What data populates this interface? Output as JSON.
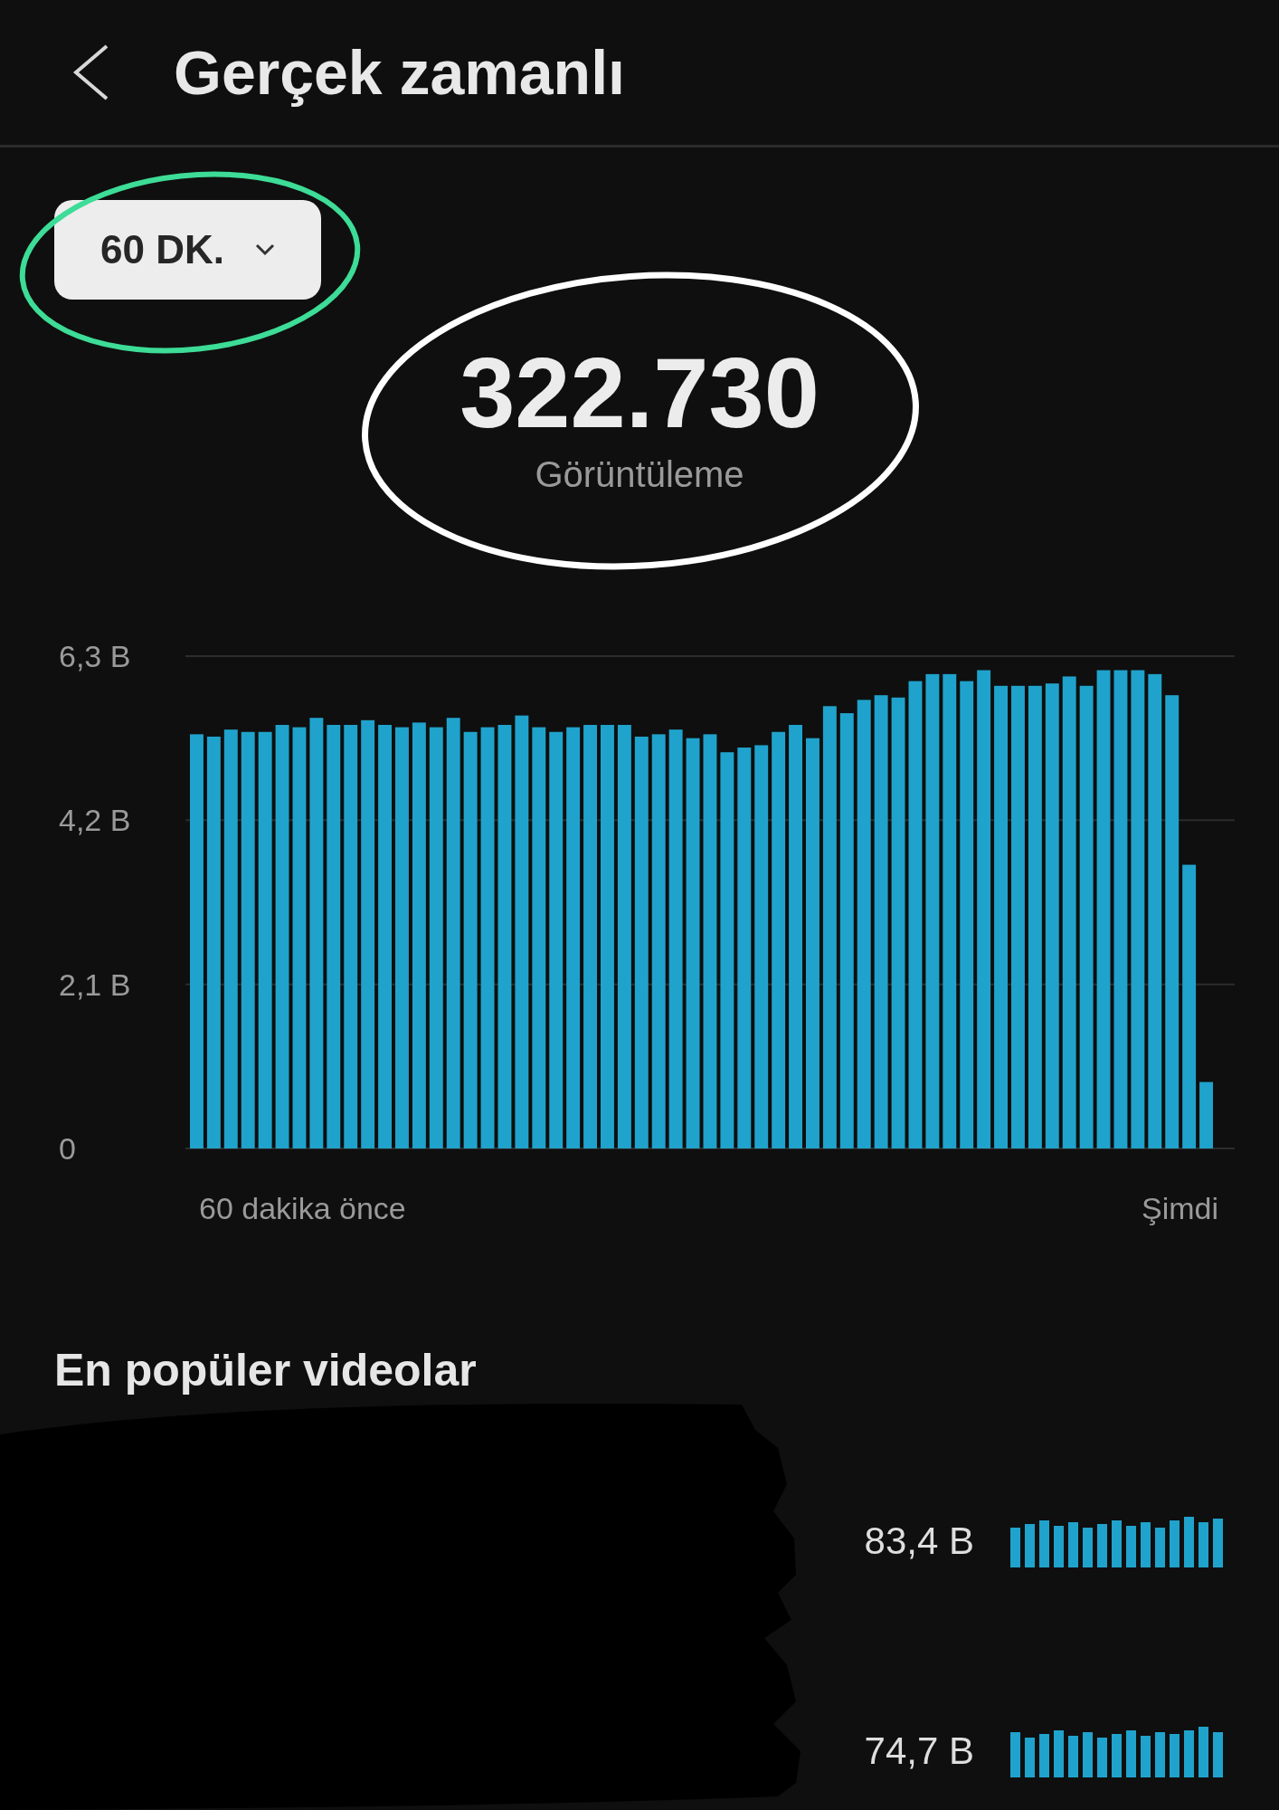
{
  "header": {
    "title": "Gerçek zamanlı"
  },
  "time_range": {
    "label": "60 DK."
  },
  "total": {
    "value": "322.730",
    "label": "Görüntüleme"
  },
  "chart": {
    "start_label": "60 dakika önce",
    "end_label": "Şimdi",
    "chart_data": {
      "type": "bar",
      "yticks": [
        {
          "value": 0,
          "label": "0"
        },
        {
          "value": 2.1,
          "label": "2,1 B"
        },
        {
          "value": 4.2,
          "label": "4,2 B"
        },
        {
          "value": 6.3,
          "label": "6,3 B"
        }
      ],
      "ylim": [
        0,
        6.3
      ],
      "series": [
        {
          "color": "#1fa3cc",
          "values": [
            5.3,
            5.27,
            5.36,
            5.33,
            5.33,
            5.42,
            5.39,
            5.51,
            5.42,
            5.42,
            5.48,
            5.42,
            5.39,
            5.45,
            5.39,
            5.51,
            5.33,
            5.39,
            5.42,
            5.54,
            5.39,
            5.33,
            5.39,
            5.42,
            5.42,
            5.42,
            5.27,
            5.3,
            5.36,
            5.25,
            5.3,
            5.07,
            5.13,
            5.16,
            5.33,
            5.42,
            5.25,
            5.66,
            5.57,
            5.74,
            5.8,
            5.77,
            5.98,
            6.07,
            6.07,
            5.98,
            6.12,
            5.92,
            5.92,
            5.92,
            5.95,
            6.04,
            5.92,
            6.12,
            6.12,
            6.12,
            6.07,
            5.8,
            3.63,
            0.85
          ]
        }
      ]
    }
  },
  "top_videos": {
    "heading": "En popüler videolar",
    "rows": [
      {
        "views": "83,4 B"
      },
      {
        "views": "74,7 B"
      }
    ]
  }
}
